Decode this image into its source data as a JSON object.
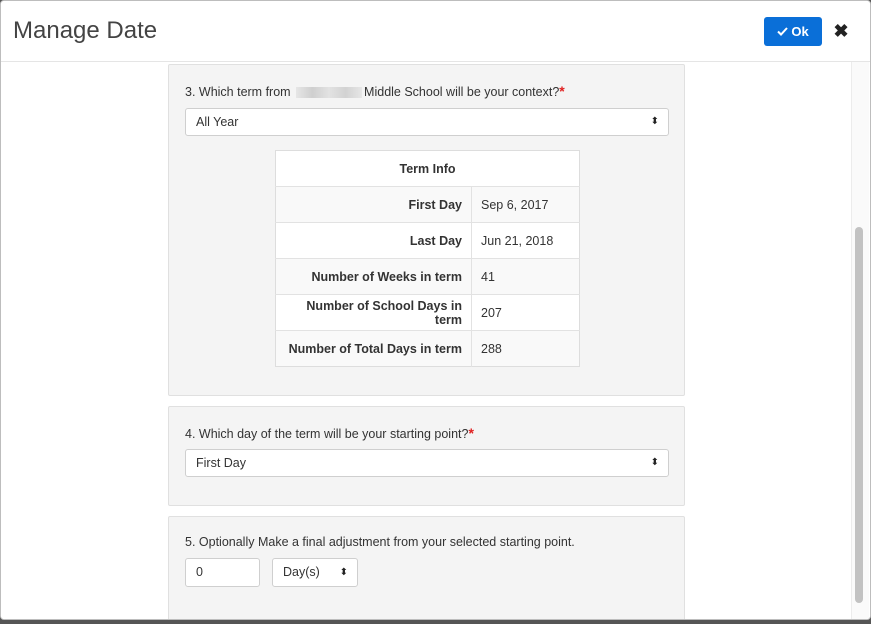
{
  "modal": {
    "title": "Manage Date",
    "ok_label": "Ok",
    "ok_icon": "check-icon",
    "close_glyph": "✖"
  },
  "q3": {
    "text_before": "3. Which term from ",
    "text_after": "Middle School will be your context?",
    "required_mark": "*",
    "selected": "All Year"
  },
  "term_info": {
    "header": "Term Info",
    "rows": [
      {
        "label": "First Day",
        "value": "Sep 6, 2017"
      },
      {
        "label": "Last Day",
        "value": "Jun 21, 2018"
      },
      {
        "label": "Number of Weeks in term",
        "value": "41"
      },
      {
        "label": "Number of School Days in term",
        "value": "207"
      },
      {
        "label": "Number of Total Days in term",
        "value": "288"
      }
    ]
  },
  "q4": {
    "text": "4. Which day of the term will be your starting point?",
    "required_mark": "*",
    "selected": "First Day"
  },
  "q5": {
    "text": "5. Optionally Make a final adjustment from your selected starting point.",
    "amount_value": "0",
    "unit_selected": "Day(s)"
  },
  "select_arrows": "⬍",
  "colors": {
    "primary_button": "#0a6fd8",
    "required": "#e02020",
    "panel_bg": "#f4f4f4"
  }
}
